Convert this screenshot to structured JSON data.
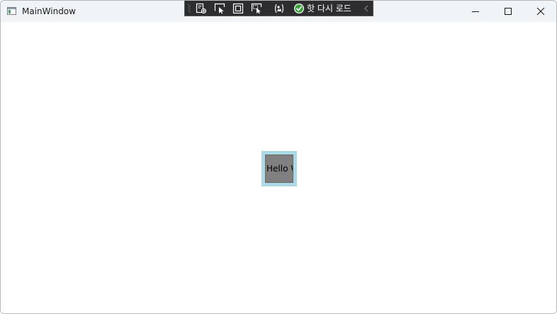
{
  "window": {
    "title": "MainWindow",
    "app_icon": "window-app-icon",
    "controls": {
      "minimize_icon": "minimize-icon",
      "maximize_icon": "maximize-icon",
      "close_icon": "close-icon"
    }
  },
  "devtools_toolbar": {
    "tools": [
      {
        "icon": "live-visual-tree-icon"
      },
      {
        "icon": "select-element-icon"
      },
      {
        "icon": "display-layout-adorners-icon"
      },
      {
        "icon": "track-focus-icon"
      },
      {
        "icon": "binding-failures-icon"
      }
    ],
    "hot_reload_icon": "check-circle-icon",
    "hot_reload_label": "핫 다시 로드",
    "collapse_icon": "chevron-left-icon"
  },
  "content": {
    "button_text": "Hello World",
    "colors": {
      "outer_border": "#add8e6",
      "button_background": "#808080",
      "text": "#000000"
    }
  },
  "colors": {
    "titlebar": "#eff4f9",
    "devbar_background": "#2d2d30",
    "hot_reload_check": "#3ca03c"
  }
}
